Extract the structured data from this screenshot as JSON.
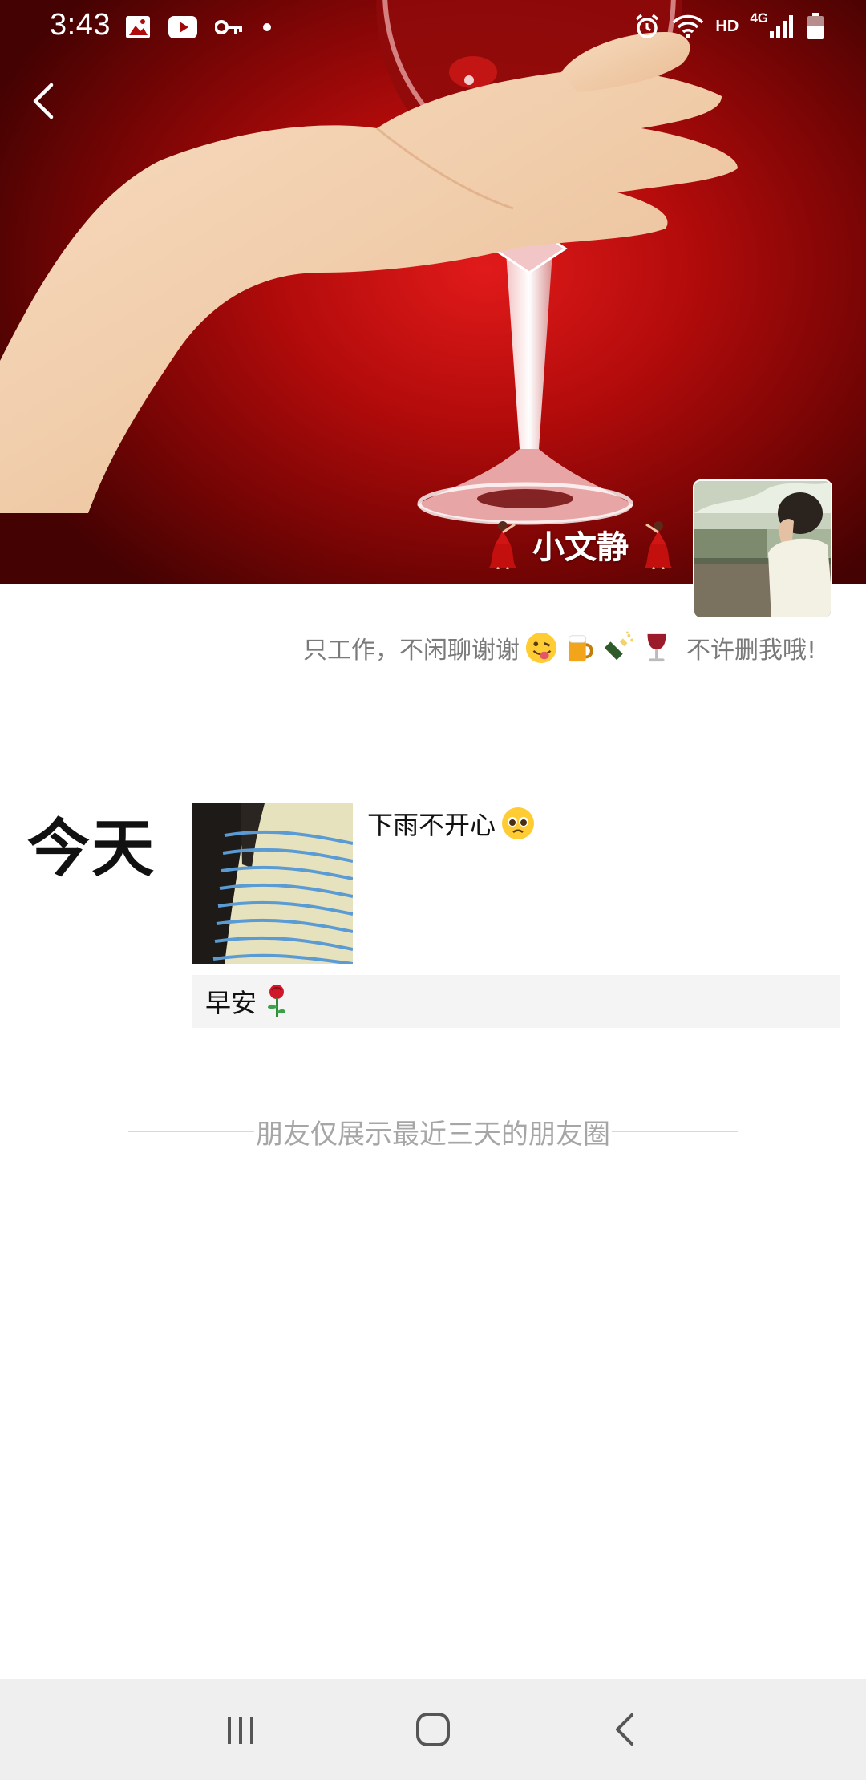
{
  "status_bar": {
    "time": "3:43",
    "hd": "HD",
    "network": "4G",
    "left_icons": [
      "image-icon",
      "youtube-icon",
      "key-icon",
      "dot-icon"
    ],
    "right_icons": [
      "alarm-icon",
      "wifi-icon",
      "signal-icon",
      "battery-icon"
    ]
  },
  "header": {
    "back_icon": "back-arrow-icon",
    "name": "小文静",
    "name_decor_icon": "dancer-icon",
    "signature": "只工作，不闲聊谢谢",
    "signature_tail": "不许删我哦!",
    "signature_emojis": [
      "tongue-wink-emoji",
      "beer-emoji",
      "champagne-emoji",
      "wine-emoji"
    ]
  },
  "timeline": {
    "day": "今天",
    "posts": [
      {
        "text": "下雨不开心",
        "emoji": "pleading-face-emoji",
        "has_image": true
      },
      {
        "text": "早安",
        "emoji": "rose-emoji",
        "has_image": false
      }
    ],
    "footer": "朋友仅展示最近三天的朋友圈"
  },
  "nav_bar": {
    "buttons": [
      "recent-apps-icon",
      "home-icon",
      "back-icon"
    ]
  },
  "colors": {
    "cover_red": "#b30b0b",
    "signature_gray": "#7a7a7a",
    "footer_gray": "#a6a6a6",
    "nav_bg": "#efefef"
  }
}
